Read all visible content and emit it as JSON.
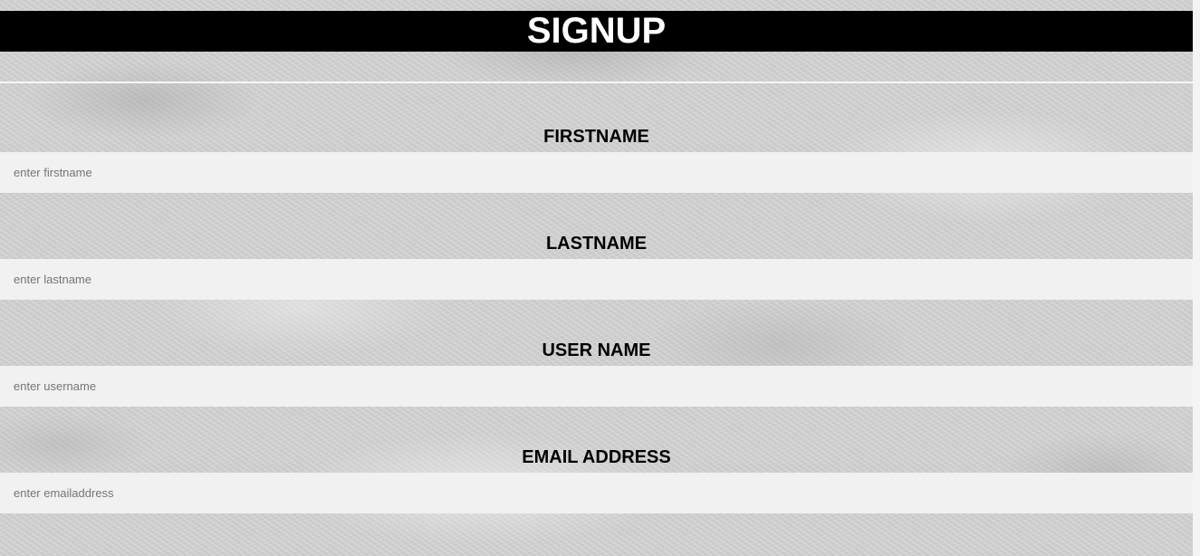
{
  "header": {
    "title": "SIGNUP"
  },
  "form": {
    "fields": [
      {
        "label": "FIRSTNAME",
        "placeholder": "enter firstname",
        "value": ""
      },
      {
        "label": "LASTNAME",
        "placeholder": "enter lastname",
        "value": ""
      },
      {
        "label": "USER NAME",
        "placeholder": "enter username",
        "value": ""
      },
      {
        "label": "EMAIL ADDRESS",
        "placeholder": "enter emailaddress",
        "value": ""
      }
    ]
  },
  "colors": {
    "header_background": "#000000",
    "header_text": "#ffffff",
    "input_background": "#f1f1f1",
    "label_text": "#000000",
    "placeholder_text": "#757575"
  }
}
